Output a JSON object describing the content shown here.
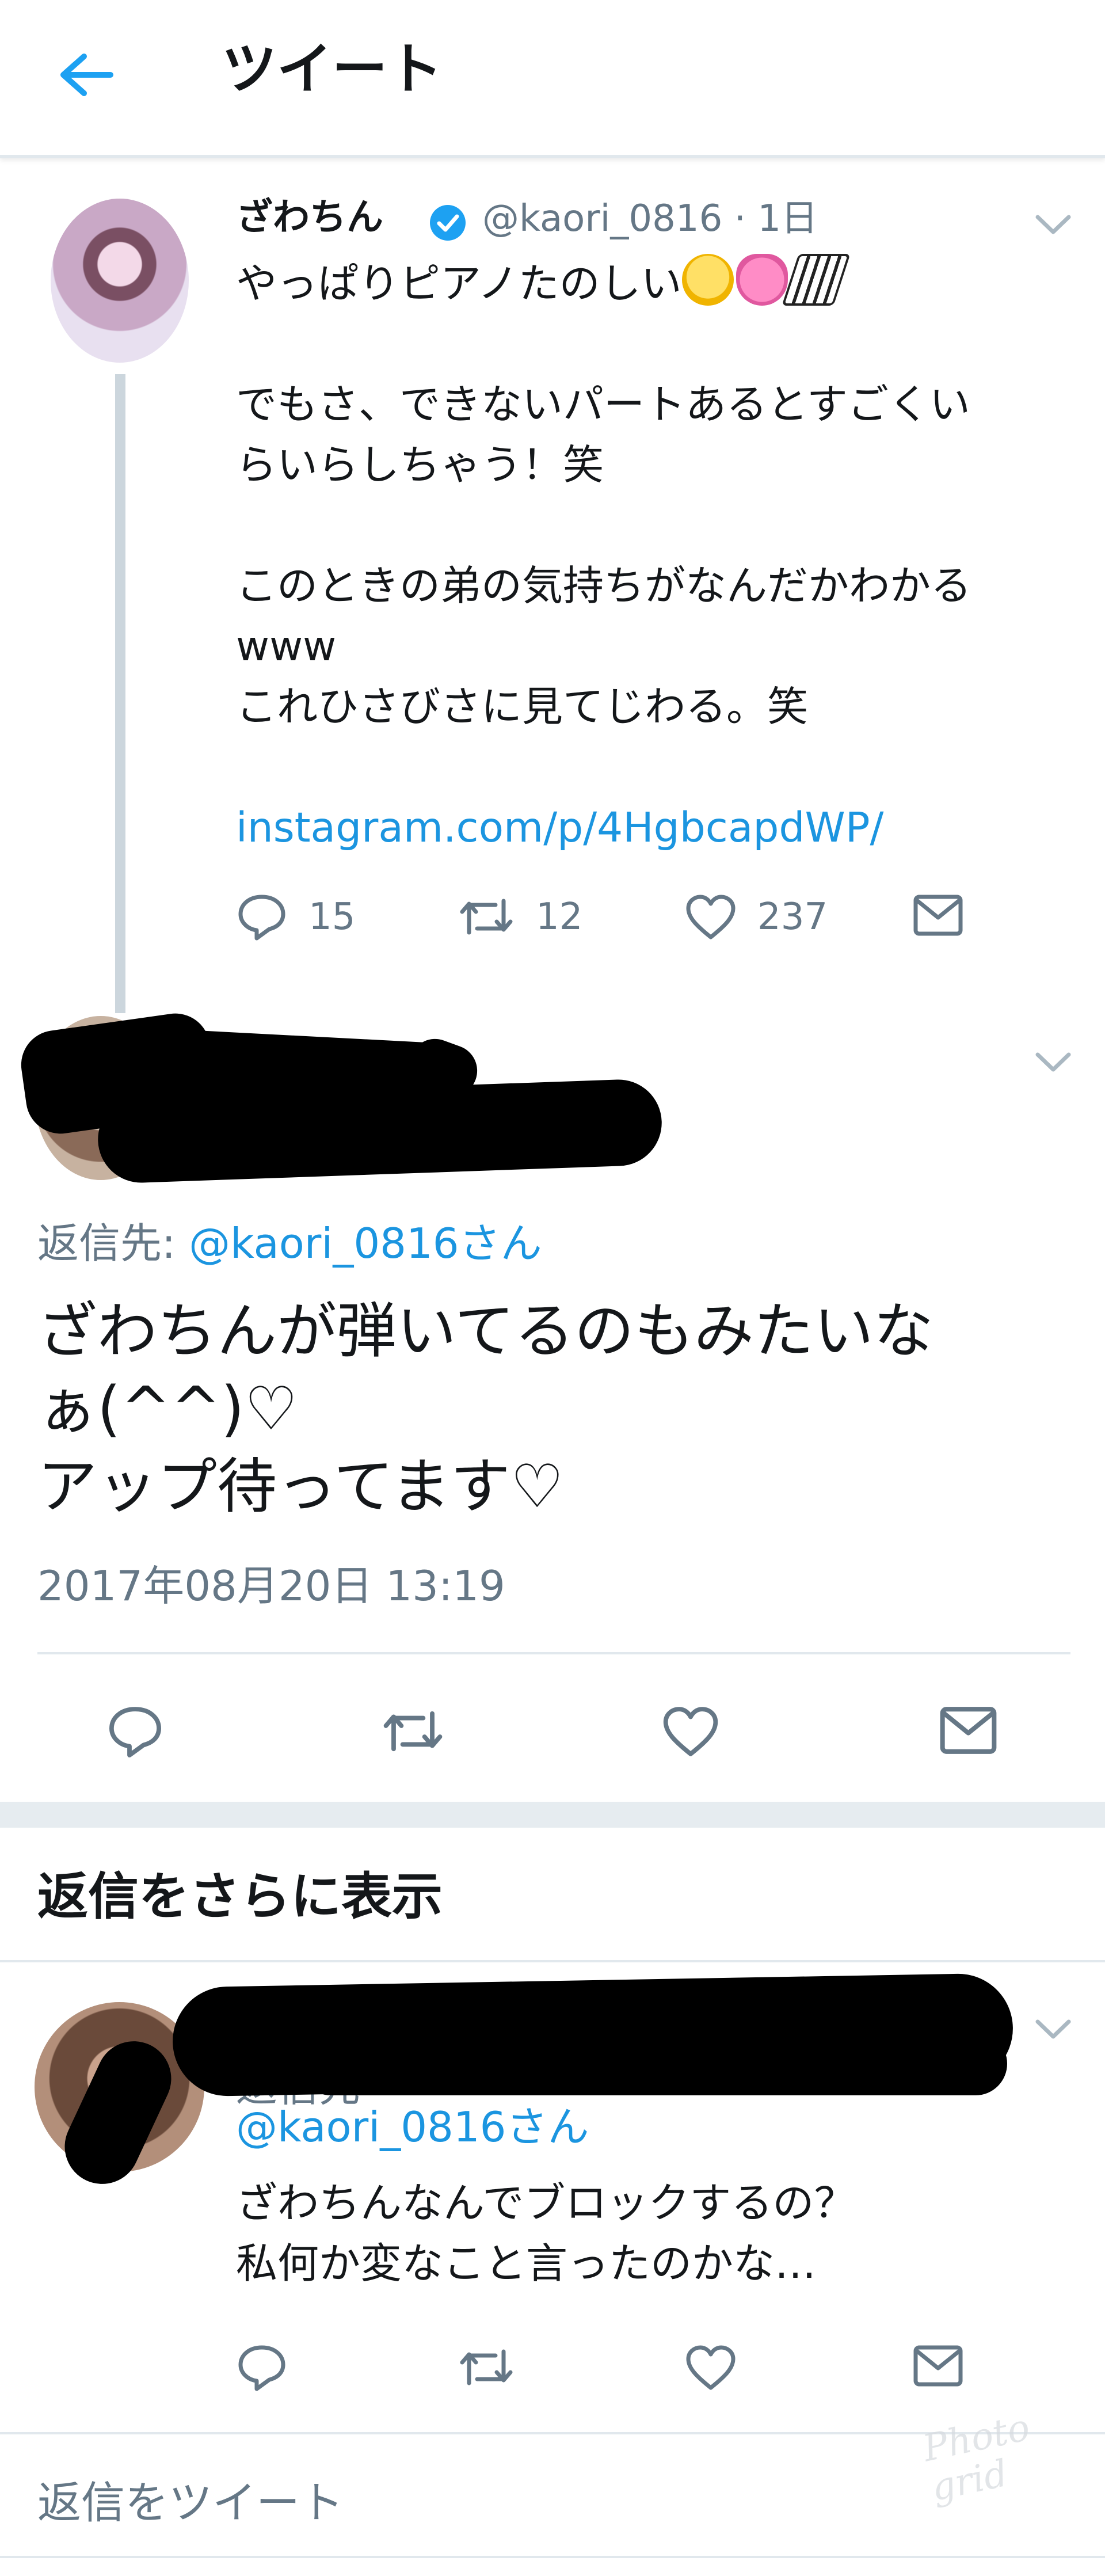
{
  "header": {
    "title": "ツイート"
  },
  "tweet1": {
    "name": "ざわちん",
    "handle": "@kaori_0816",
    "age": "· 1日",
    "lines": [
      "やっぱりピアノたのしい",
      "",
      "でもさ、できないパートあるとすごくい",
      "らいらしちゃう！笑",
      "",
      "このときの弟の気持ちがなんだかわかる",
      "www",
      "これひさびさに見てじわる。笑",
      ""
    ],
    "link": "instagram.com/p/4HgbcapdWP/",
    "reply_count": "15",
    "retweet_count": "12",
    "like_count": "237"
  },
  "tweet2": {
    "replyto_prefix": "返信先: ",
    "replyto_handle": "@kaori_0816さん",
    "lines": [
      "ざわちんが弾いてるのもみたいな",
      "ぁ(^^)♡",
      "アップ待ってます♡"
    ],
    "timestamp": "2017年08月20日 13:19"
  },
  "more_replies": "返信をさらに表示",
  "tweet3": {
    "replyto_partial": "返信先",
    "replyto_handle": "@kaori_0816さん",
    "lines": [
      "ざわちんなんでブロックするの？",
      "私何か変なこと言ったのかな…"
    ]
  },
  "reply_input": {
    "placeholder": "返信をツイート"
  },
  "watermark": "Photo grid",
  "colors": {
    "accent": "#1b95e0",
    "muted": "#657786",
    "divider": "#e1e8ed",
    "verified": "#1da1f2"
  }
}
